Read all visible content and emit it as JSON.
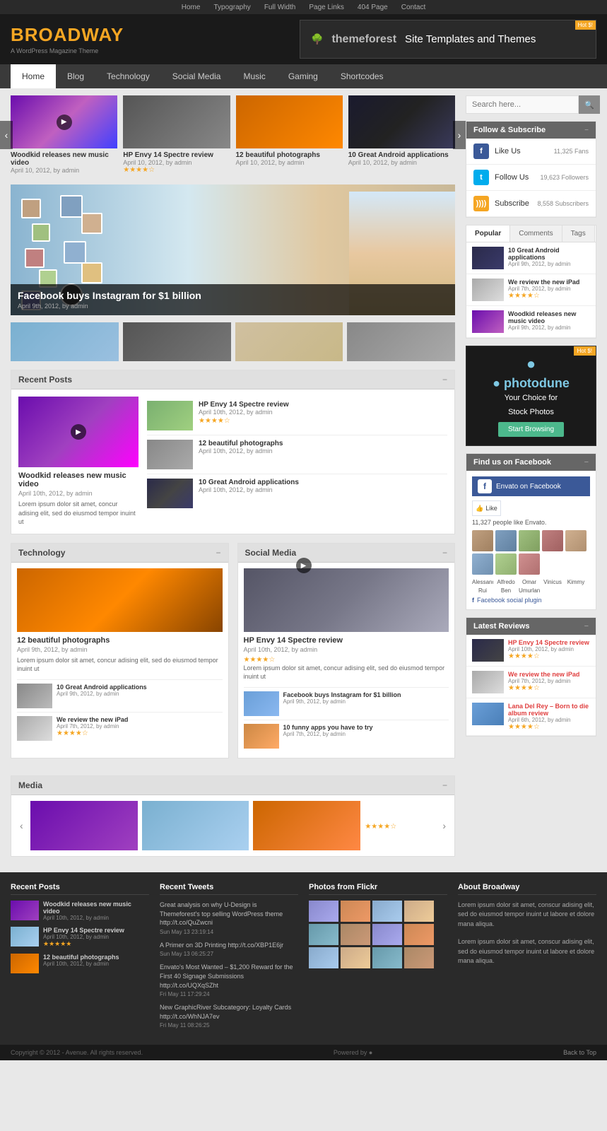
{
  "topNav": {
    "links": [
      "Home",
      "Typography",
      "Full Width",
      "Page Links",
      "404 Page",
      "Contact"
    ]
  },
  "header": {
    "logo": {
      "text1": "BROAD",
      "text2": "WAY",
      "subtext": "A WordPress Magazine Theme"
    },
    "ad": {
      "logo": "themeforest",
      "text": "Site Templates and Themes",
      "badge": "Hot $!"
    }
  },
  "mainNav": {
    "items": [
      "Home",
      "Blog",
      "Technology",
      "Social Media",
      "Music",
      "Gaming",
      "Shortcodes"
    ],
    "active": "Home"
  },
  "sliderPosts": [
    {
      "title": "Woodkid releases new music video",
      "date": "April 10, 2012",
      "by": "admin",
      "type": "video",
      "theme": "purple"
    },
    {
      "title": "HP Envy 14 Spectre review",
      "date": "April 10, 2012",
      "by": "admin",
      "theme": "gray",
      "stars": 4
    },
    {
      "title": "12 beautiful photographs",
      "date": "April 10, 2012",
      "by": "admin",
      "theme": "orange"
    },
    {
      "title": "10 Great Android applications",
      "date": "April 10, 2012",
      "by": "admin",
      "theme": "dark"
    }
  ],
  "featuredPost": {
    "title": "Facebook buys Instagram for $1 billion",
    "date": "April 9th, 2012",
    "by": "admin"
  },
  "sidebar": {
    "searchPlaceholder": "Search here...",
    "followSubscribe": {
      "title": "Follow & Subscribe",
      "items": [
        {
          "icon": "fb",
          "label": "Like Us",
          "count": "11,325 Fans"
        },
        {
          "icon": "tw",
          "label": "Follow Us",
          "count": "19,623 Followers"
        },
        {
          "icon": "rss",
          "label": "Subscribe",
          "count": "8,558 Subscribers"
        }
      ]
    },
    "tabs": {
      "buttons": [
        "Popular",
        "Comments",
        "Tags"
      ],
      "active": "Popular",
      "items": [
        {
          "title": "10 Great Android applications",
          "date": "April 9th, 2012",
          "by": "admin",
          "thumb": "t1"
        },
        {
          "title": "We review the new iPad",
          "date": "April 7th, 2012",
          "by": "admin",
          "stars": 4,
          "thumb": "t2"
        },
        {
          "title": "Woodkid releases new music video",
          "date": "April 9th, 2012",
          "by": "admin",
          "thumb": "t3"
        }
      ]
    },
    "photodune": {
      "logo": "● photodune",
      "tagline1": "Your Choice for",
      "tagline2": "Stock Photos",
      "cta": "Start Browsing",
      "badge": "Hot $!"
    },
    "facebook": {
      "title": "Find us on Facebook",
      "envato": "Envato on Facebook",
      "likeBtn": "Like",
      "count": "11,327 people like Envato.",
      "names": [
        "Alessandro",
        "Alfredo",
        "Omar",
        "Vinicus",
        "Kimmy",
        "Rui",
        "Ben",
        "Umurlan"
      ],
      "plugin": "Facebook social plugin"
    },
    "latestReviews": {
      "title": "Latest Reviews",
      "items": [
        {
          "title": "HP Envy 14 Spectre review",
          "date": "April 10th, 2012",
          "by": "admin",
          "stars": 4,
          "thumb": "r1"
        },
        {
          "title": "We review the new iPad",
          "date": "April 7th, 2012",
          "by": "admin",
          "stars": 4,
          "thumb": "r2"
        },
        {
          "title": "Lana Del Rey – Born to die album review",
          "date": "April 6th, 2012",
          "by": "admin",
          "stars": 4,
          "thumb": "r3"
        }
      ]
    }
  },
  "recentPosts": {
    "title": "Recent Posts",
    "mainPost": {
      "title": "Woodkid releases new music video",
      "date": "April 10th, 2012",
      "by": "admin",
      "excerpt": "Lorem ipsum dolor sit amet, concur adising elit, sed do eiusmod tempor inuint ut"
    },
    "sideItems": [
      {
        "title": "HP Envy 14 Spectre review",
        "date": "April 10th, 2012",
        "by": "admin",
        "stars": 4,
        "thumb": "green"
      },
      {
        "title": "12 beautiful photographs",
        "date": "April 10th, 2012",
        "by": "admin",
        "thumb": "gray2"
      },
      {
        "title": "10 Great Android applications",
        "date": "April 10th, 2012",
        "by": "admin",
        "thumb": "dark2"
      }
    ]
  },
  "technology": {
    "title": "Technology",
    "mainPost": {
      "title": "12 beautiful photographs",
      "date": "April 9th, 2012",
      "by": "admin",
      "excerpt": "Lorem ipsum dolor sit amet, concur adising elit, sed do eiusmod tempor inuint ut"
    },
    "items": [
      {
        "title": "10 Great Android applications",
        "date": "April 9th, 2012",
        "by": "admin",
        "thumb": "tab"
      },
      {
        "title": "We review the new iPad",
        "date": "April 7th, 2012",
        "by": "admin",
        "stars": 4,
        "thumb": "ipad"
      }
    ]
  },
  "socialMedia": {
    "title": "Social Media",
    "mainPost": {
      "title": "HP Envy 14 Spectre review",
      "date": "April 10th, 2012",
      "by": "admin",
      "stars": 4,
      "excerpt": "Lorem ipsum dolor sit amet, concur adising elit, sed do eiusmod tempor inuint ut"
    },
    "items": [
      {
        "title": "Facebook buys Instagram for $1 billion",
        "date": "April 9th, 2012",
        "by": "admin",
        "thumb": "fb"
      },
      {
        "title": "10 funny apps you have to try",
        "date": "April 7th, 2012",
        "by": "admin",
        "thumb": "fun"
      }
    ]
  },
  "media": {
    "title": "Media"
  },
  "footer": {
    "recentPosts": {
      "title": "Recent Posts",
      "items": [
        {
          "title": "Woodkid releases new music video",
          "date": "April 10th, 2012",
          "by": "admin",
          "thumb": "fp1"
        },
        {
          "title": "HP Envy 14 Spectre review",
          "date": "April 10th, 2012",
          "by": "admin",
          "stars": 5,
          "thumb": "fp2"
        },
        {
          "title": "12 beautiful photographs",
          "date": "April 10th, 2012",
          "by": "admin",
          "thumb": "fp3"
        }
      ]
    },
    "tweets": {
      "title": "Recent Tweets",
      "items": [
        {
          "text": "Great analysis on why U-Design is Themeforest's top selling WordPress theme http://t.co/QuZwcni",
          "date": "Sun May 13 23:19:14"
        },
        {
          "text": "A Primer on 3D Printing http://t.co/XBP1E6jr",
          "date": "Sun May 13 06:25:27"
        },
        {
          "text": "Envato's Most Wanted – $1,200 Reward for the First 40 Signage Submissions http://t.co/UQXqSZht",
          "date": "Fri May 11 17:29:24"
        },
        {
          "text": "New GraphicRiver Subcategory: Loyalty Cards http://t.co/WhNJA7ev",
          "date": "Fri May 11 08:26:25"
        }
      ]
    },
    "flickr": {
      "title": "Photos from Flickr"
    },
    "about": {
      "title": "About Broadway",
      "text1": "Lorem ipsum dolor sit amet, conscur adising elit, sed do eiusmod tempor inuint ut labore et dolore mana aliqua.",
      "text2": "Lorem ipsum dolor sit amet, conscur adising elit, sed do eiusmod tempor inuint ut labore et dolore mana aliqua."
    }
  },
  "footerBottom": {
    "copyright": "Copyright © 2012 - Avenue. All rights reserved.",
    "poweredBy": "Powered by ●",
    "backTop": "Back to Top"
  }
}
